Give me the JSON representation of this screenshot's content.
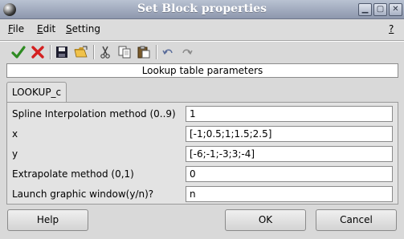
{
  "window": {
    "title": "Set Block properties",
    "buttons": [
      {
        "name": "minimize-button",
        "glyph": "▁"
      },
      {
        "name": "maximize-button",
        "glyph": "▢"
      },
      {
        "name": "close-button",
        "glyph": "✕"
      }
    ]
  },
  "menubar": {
    "file": {
      "accel": "F",
      "rest": "ile"
    },
    "edit": {
      "accel": "E",
      "rest": "dit"
    },
    "setting": {
      "accel": "S",
      "rest": "etting"
    },
    "help": {
      "accel": "?",
      "rest": ""
    }
  },
  "toolbar": {
    "icons": [
      "ok-check-icon",
      "cancel-x-icon",
      "save-icon",
      "open-folder-icon",
      "cut-icon",
      "copy-icon",
      "paste-icon",
      "undo-icon",
      "redo-icon"
    ]
  },
  "header": {
    "label": "Lookup table parameters"
  },
  "tab": {
    "label": "LOOKUP_c"
  },
  "fields": [
    {
      "label": "Spline Interpolation method (0..9)",
      "value": "1"
    },
    {
      "label": "x",
      "value": "[-1;0.5;1;1.5;2.5]"
    },
    {
      "label": "y",
      "value": "[-6;-1;-3;3;-4]"
    },
    {
      "label": "Extrapolate method (0,1)",
      "value": "0"
    },
    {
      "label": "Launch graphic window(y/n)?",
      "value": "n"
    }
  ],
  "footer": {
    "help": "Help",
    "ok": "OK",
    "cancel": "Cancel"
  },
  "colors": {
    "titlebar": "#9aa3b8",
    "check": "#2e8b22",
    "x": "#d42020"
  }
}
